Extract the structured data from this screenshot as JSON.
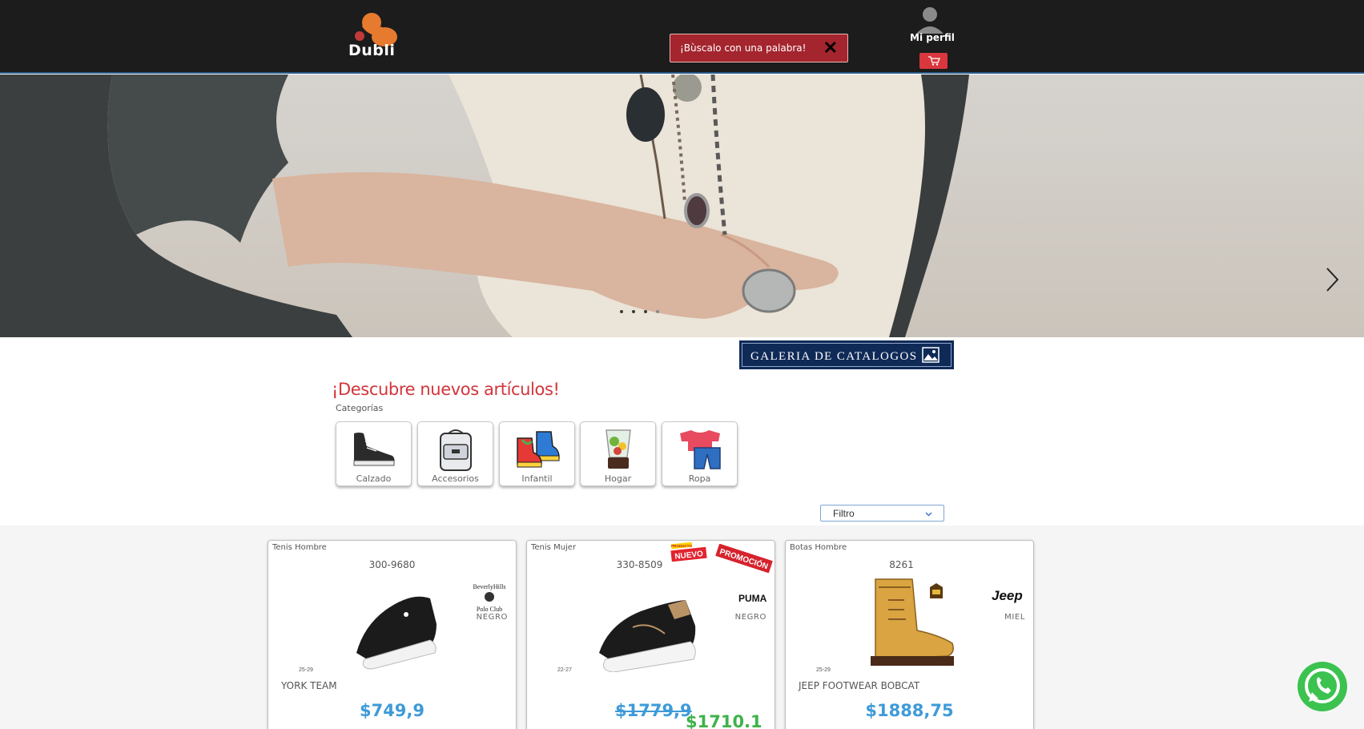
{
  "header": {
    "logo_text": "Dubli",
    "search_placeholder": "¡Bùscalo con una palabra!",
    "profile_label": "Mi perfil"
  },
  "hero": {
    "slides": 4
  },
  "galeria": {
    "label": "GALERIA DE CATALOGOS"
  },
  "discover": {
    "title": "¡Descubre nuevos artículos!",
    "categories_label": "Categorías",
    "categories": [
      {
        "label": "Calzado",
        "icon": "sneaker-icon"
      },
      {
        "label": "Accesorios",
        "icon": "backpack-icon"
      },
      {
        "label": "Infantil",
        "icon": "kids-shoes-icon"
      },
      {
        "label": "Hogar",
        "icon": "blender-icon"
      },
      {
        "label": "Ropa",
        "icon": "clothes-icon"
      }
    ]
  },
  "filter": {
    "selected": "Filtro"
  },
  "products": [
    {
      "category": "Tenis Hombre",
      "sku": "300-9680",
      "brand": "Beverly Hills Polo Club",
      "color": "NEGRO",
      "sizes": "25-29",
      "name": "YORK TEAM",
      "price": "$749,9"
    },
    {
      "category": "Tenis Mujer",
      "sku": "330-8509",
      "brand": "PUMA",
      "color": "NEGRO",
      "sizes": "22-27",
      "name": "",
      "price_old": "$1779,9",
      "price_new": "$1710.1",
      "badges": [
        "NUEVO",
        "PROMOCIÓN"
      ],
      "badge_small": "PRODUCTO"
    },
    {
      "category": "Botas Hombre",
      "sku": "8261",
      "brand": "Jeep",
      "color": "MIEL",
      "sizes": "25-29",
      "name": "JEEP FOOTWEAR BOBCAT",
      "price": "$1888,75"
    }
  ],
  "colors": {
    "header_bg": "#1c1c1c",
    "search_bg": "#a4252e",
    "accent_red": "#d2353b",
    "price_blue": "#3e9bd8",
    "price_green": "#3fb24a",
    "galeria_bg": "#0f2a57",
    "whatsapp": "#3cc24f"
  }
}
